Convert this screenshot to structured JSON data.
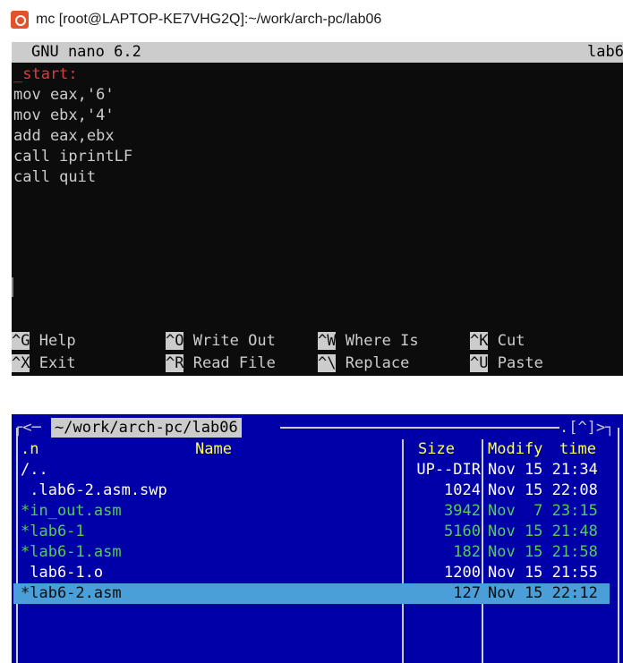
{
  "window1": {
    "title": "mc [root@LAPTOP-KE7VHG2Q]:~/work/arch-pc/lab06",
    "nano_version": "GNU nano 6.2",
    "filename_partial": "lab6",
    "code_lines": [
      "_start:",
      "mov eax,'6'",
      "mov ebx,'4'",
      "add eax,ebx",
      "call iprintLF",
      "call quit"
    ],
    "shortcuts": {
      "help": {
        "key": "^G",
        "label": " Help"
      },
      "exit": {
        "key": "^X",
        "label": " Exit"
      },
      "write_out": {
        "key": "^O",
        "label": " Write Out"
      },
      "read_file": {
        "key": "^R",
        "label": " Read File"
      },
      "where_is": {
        "key": "^W",
        "label": " Where Is"
      },
      "replace": {
        "key": "^\\",
        "label": " Replace"
      },
      "cut": {
        "key": "^K",
        "label": " Cut"
      },
      "paste": {
        "key": "^U",
        "label": " Paste"
      }
    }
  },
  "window2": {
    "left_corner": "┌<─",
    "panel_path": "~/work/arch-pc/lab06",
    "right_corner": ".[^]>┐",
    "headers": {
      "n": ".n",
      "name": "Name",
      "size": "Size",
      "modify": "Modify",
      "time": "time"
    },
    "rows": [
      {
        "name": "/..",
        "size": "UP--DIR",
        "date": "Nov 15 21:34",
        "style": "white"
      },
      {
        "name": " .lab6-2.asm.swp",
        "size": "1024",
        "date": "Nov 15 22:08",
        "style": "white"
      },
      {
        "name": "*in_out.asm",
        "size": "3942",
        "date": "Nov  7 23:15",
        "style": "green"
      },
      {
        "name": "*lab6-1",
        "size": "5160",
        "date": "Nov 15 21:48",
        "style": "green"
      },
      {
        "name": "*lab6-1.asm",
        "size": "182",
        "date": "Nov 15 21:58",
        "style": "green"
      },
      {
        "name": " lab6-1.o",
        "size": "1200",
        "date": "Nov 15 21:55",
        "style": "white"
      },
      {
        "name": "*lab6-2.asm",
        "size": "127",
        "date": "Nov 15 22:12",
        "style": "selected"
      }
    ]
  },
  "icons": {
    "app_icon": "ubuntu-terminal-icon"
  }
}
